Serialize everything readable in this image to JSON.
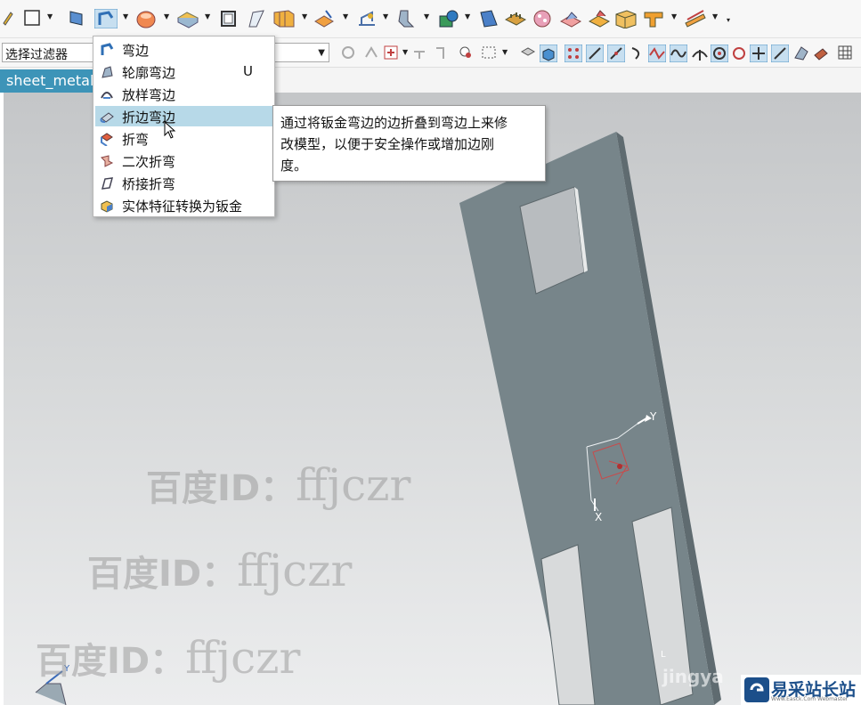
{
  "toolbar": {
    "icons": [
      "new-icon",
      "rectangle-icon",
      "sketch-icon",
      "flange-icon",
      "cylinder-icon",
      "extrude-icon",
      "frame-icon",
      "trim-icon",
      "gusset-icon",
      "chamfer-icon",
      "datum-icon",
      "tab-icon",
      "cube-icon",
      "explode-icon",
      "closed-corner-icon",
      "stamp-icon",
      "louver-icon",
      "bead-icon",
      "contour-icon",
      "gear-icon"
    ],
    "filter": {
      "label": "选择过滤器"
    }
  },
  "tab": {
    "label": "sheet_metal"
  },
  "menu": {
    "items": [
      {
        "label": "弯边",
        "icon": "flange-icon",
        "shortcut": ""
      },
      {
        "label": "轮廓弯边",
        "icon": "contour-flange-icon",
        "shortcut": "U"
      },
      {
        "label": "放样弯边",
        "icon": "lofted-flange-icon",
        "shortcut": ""
      },
      {
        "label": "折边弯边",
        "icon": "hem-flange-icon",
        "shortcut": ""
      },
      {
        "label": "折弯",
        "icon": "bend-icon",
        "shortcut": ""
      },
      {
        "label": "二次折弯",
        "icon": "jog-icon",
        "shortcut": ""
      },
      {
        "label": "桥接折弯",
        "icon": "bridge-bend-icon",
        "shortcut": ""
      },
      {
        "label": "实体特征转换为钣金",
        "icon": "convert-solid-icon",
        "shortcut": ""
      }
    ],
    "highlighted_index": 3
  },
  "tooltip": {
    "line1": "通过将钣金弯边的边折叠到弯边上来修",
    "line2": "改模型，以便于安全操作或增加边刚",
    "line3": "度。"
  },
  "model": {
    "axis_y": "Y",
    "axis_x": "X",
    "axis_y2": "Y",
    "corner_label": "L"
  },
  "watermarks": {
    "text1": "百度ID：",
    "id1": "ffjczr",
    "text2": "百度ID：",
    "id2": "ffjczr",
    "text3": "百度ID：",
    "id3": "ffjczr",
    "partial": "jingya"
  },
  "logo": {
    "text": "易采站长站",
    "sub": "Www.Easck.Com Webmaster"
  },
  "colors": {
    "tab": "#3d94b8",
    "highlight": "#b7d9e8",
    "plate": "#77858a"
  }
}
